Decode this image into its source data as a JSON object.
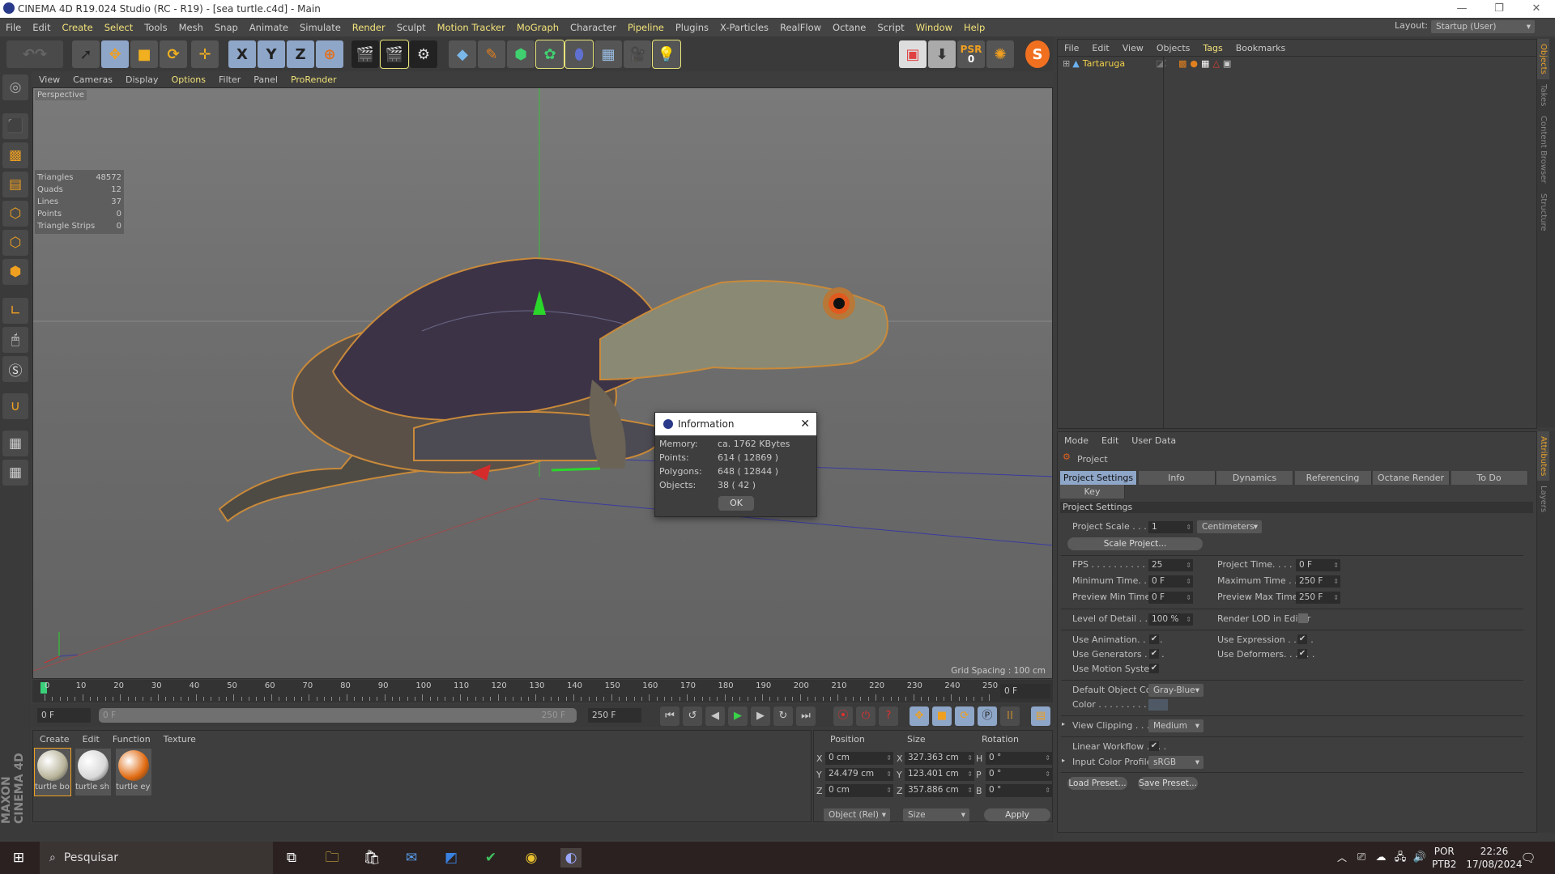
{
  "window": {
    "title": "CINEMA 4D R19.024 Studio (RC - R19) - [sea turtle.c4d] - Main",
    "minimize": "—",
    "maximize": "❐",
    "close": "✕"
  },
  "menu": [
    {
      "label": "File",
      "hl": false
    },
    {
      "label": "Edit",
      "hl": false
    },
    {
      "label": "Create",
      "hl": true
    },
    {
      "label": "Select",
      "hl": true
    },
    {
      "label": "Tools",
      "hl": false
    },
    {
      "label": "Mesh",
      "hl": false
    },
    {
      "label": "Snap",
      "hl": false
    },
    {
      "label": "Animate",
      "hl": false
    },
    {
      "label": "Simulate",
      "hl": false
    },
    {
      "label": "Render",
      "hl": true
    },
    {
      "label": "Sculpt",
      "hl": false
    },
    {
      "label": "Motion Tracker",
      "hl": true
    },
    {
      "label": "MoGraph",
      "hl": true
    },
    {
      "label": "Character",
      "hl": false
    },
    {
      "label": "Pipeline",
      "hl": true
    },
    {
      "label": "Plugins",
      "hl": false
    },
    {
      "label": "X-Particles",
      "hl": false
    },
    {
      "label": "RealFlow",
      "hl": false
    },
    {
      "label": "Octane",
      "hl": false
    },
    {
      "label": "Script",
      "hl": false
    },
    {
      "label": "Window",
      "hl": true
    },
    {
      "label": "Help",
      "hl": true
    }
  ],
  "layout": {
    "label": "Layout:",
    "value": "Startup (User)"
  },
  "toolbar": {
    "x": "X",
    "y": "Y",
    "z": "Z",
    "psr": "PSR",
    "psr_val": "0"
  },
  "viewport": {
    "menu": [
      "View",
      "Cameras",
      "Display",
      "Options",
      "Filter",
      "Panel",
      "ProRender"
    ],
    "name": "Perspective",
    "grid_spacing": "Grid Spacing : 100 cm",
    "stats": [
      {
        "k": "Triangles",
        "v": "48572"
      },
      {
        "k": "Quads",
        "v": "12"
      },
      {
        "k": "Lines",
        "v": "37"
      },
      {
        "k": "Points",
        "v": "0"
      },
      {
        "k": "Triangle Strips",
        "v": "0"
      }
    ]
  },
  "dialog": {
    "title": "Information",
    "rows": [
      {
        "k": "Memory:",
        "v": "ca. 1762 KBytes"
      },
      {
        "k": "Points:",
        "v": "614 ( 12869 )"
      },
      {
        "k": "Polygons:",
        "v": "648 ( 12844 )"
      },
      {
        "k": "Objects:",
        "v": "38 ( 42 )"
      }
    ],
    "ok": "OK"
  },
  "timeline": {
    "ticks": [
      0,
      10,
      20,
      30,
      40,
      50,
      60,
      70,
      80,
      90,
      100,
      110,
      120,
      130,
      140,
      150,
      160,
      170,
      180,
      190,
      200,
      210,
      220,
      230,
      240,
      250
    ],
    "current": "0 F",
    "start": "0 F",
    "range_start": "0 F",
    "range_end": "250 F",
    "end": "250 F"
  },
  "materials": {
    "menu": [
      "Create",
      "Edit",
      "Function",
      "Texture"
    ],
    "items": [
      {
        "name": "turtle bo",
        "color": "#b8b49a"
      },
      {
        "name": "turtle sh",
        "color": "#d8d8d8"
      },
      {
        "name": "turtle ey",
        "color": "#e06a10"
      }
    ]
  },
  "coords": {
    "headers": [
      "Position",
      "Size",
      "Rotation"
    ],
    "rows": [
      {
        "a": "X",
        "p": "0 cm",
        "s": "327.363 cm",
        "r": "H",
        "rv": "0 °"
      },
      {
        "a": "Y",
        "p": "24.479 cm",
        "s": "123.401 cm",
        "r": "P",
        "rv": "0 °"
      },
      {
        "a": "Z",
        "p": "0 cm",
        "s": "357.886 cm",
        "r": "B",
        "rv": "0 °"
      }
    ],
    "mode": "Object (Rel)",
    "size_mode": "Size",
    "apply": "Apply"
  },
  "objects": {
    "menu": [
      "File",
      "Edit",
      "View",
      "Objects",
      "Tags",
      "Bookmarks"
    ],
    "object": "Tartaruga"
  },
  "side_tabs_top": [
    "Objects",
    "Takes",
    "Content Browser",
    "Structure"
  ],
  "side_tabs_bottom": [
    "Attributes",
    "Layers"
  ],
  "attributes": {
    "menu": [
      "Mode",
      "Edit",
      "User Data"
    ],
    "title": "Project",
    "tabs": [
      "Project Settings",
      "Info",
      "Dynamics",
      "Referencing",
      "Octane Render",
      "To Do"
    ],
    "tab2": "Key Interpolation",
    "section": "Project Settings",
    "project_scale": {
      "label": "Project Scale . . . . . . .",
      "value": "1",
      "unit": "Centimeters"
    },
    "scale_project": "Scale Project...",
    "fps": {
      "label": "FPS . . . . . . . . . . . . . .",
      "value": "25"
    },
    "project_time": {
      "label": "Project Time. . . . . . . .",
      "value": "0 F"
    },
    "min_time": {
      "label": "Minimum Time. . . . .",
      "value": "0 F"
    },
    "max_time": {
      "label": "Maximum Time . . . . .",
      "value": "250 F"
    },
    "prev_min": {
      "label": "Preview Min Time . .",
      "value": "0 F"
    },
    "prev_max": {
      "label": "Preview Max Time . . .",
      "value": "250 F"
    },
    "lod": {
      "label": "Level of Detail . . . . .",
      "value": "100 %"
    },
    "render_lod": "Render LOD in Editor",
    "use_animation": "Use Animation. . . . .",
    "use_expression": "Use Expression . . . . .",
    "use_generators": "Use Generators . . . .",
    "use_deformers": "Use Deformers. . . . . .",
    "use_motion": "Use Motion System",
    "default_color": {
      "label": "Default Object Color",
      "value": "Gray-Blue"
    },
    "color": {
      "label": "Color . . . . . . . . . . .",
      "swatch": "#4f5966"
    },
    "view_clipping": {
      "label": "View Clipping . . . . . .",
      "value": "Medium"
    },
    "linear": "Linear Workflow . . . .",
    "input_profile": {
      "label": "Input Color Profile .",
      "value": "sRGB"
    },
    "load_preset": "Load Preset...",
    "save_preset": "Save Preset...",
    "check": "✔"
  },
  "taskbar": {
    "search": "Pesquisar",
    "lang1": "POR",
    "lang2": "PTB2",
    "time": "22:26",
    "date": "17/08/2024"
  },
  "brand": "MAXON CINEMA 4D"
}
